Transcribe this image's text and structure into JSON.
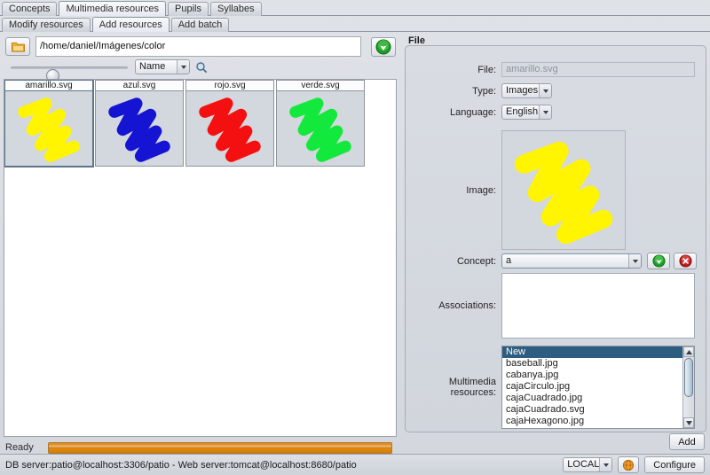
{
  "window": {
    "primary_tabs": [
      {
        "label": "Concepts",
        "active": false
      },
      {
        "label": "Multimedia resources",
        "active": true
      },
      {
        "label": "Pupils",
        "active": false
      },
      {
        "label": "Syllabes",
        "active": false
      }
    ],
    "secondary_tabs": [
      {
        "label": "Modify resources",
        "active": false
      },
      {
        "label": "Add resources",
        "active": true
      },
      {
        "label": "Add batch",
        "active": false
      }
    ]
  },
  "browser": {
    "folder_icon": "folder-icon",
    "path_value": "/home/daniel/Imágenes/color",
    "go_icon": "green-go-arrow-icon",
    "zoom_slider_value": 30,
    "sort_combo_value": "Name",
    "search_icon": "magnifier-icon",
    "files": [
      {
        "name": "amarillo.svg",
        "color": "#FFF500",
        "selected": true
      },
      {
        "name": "azul.svg",
        "color": "#1414D2",
        "selected": false
      },
      {
        "name": "rojo.svg",
        "color": "#F41010",
        "selected": false
      },
      {
        "name": "verde.svg",
        "color": "#13E93C",
        "selected": false
      }
    ],
    "status_label": "Ready",
    "progress_percent": 100
  },
  "file_panel": {
    "group_title": "File",
    "file_label": "File:",
    "file_value": "amarillo.svg",
    "type_label": "Type:",
    "type_value": "Images",
    "language_label": "Language:",
    "language_value": "English",
    "image_label": "Image:",
    "preview_color": "#FFF500",
    "concept_label": "Concept:",
    "concept_value": "a",
    "concept_add_icon": "green-add-icon",
    "concept_remove_icon": "red-remove-icon",
    "associations_label": "Associations:",
    "associations_value": "",
    "multimedia_label": "Multimedia resources:",
    "multimedia_items": [
      {
        "label": "New",
        "selected": true
      },
      {
        "label": "baseball.jpg",
        "selected": false
      },
      {
        "label": "cabanya.jpg",
        "selected": false
      },
      {
        "label": "cajaCirculo.jpg",
        "selected": false
      },
      {
        "label": "cajaCuadrado.jpg",
        "selected": false
      },
      {
        "label": "cajaCuadrado.svg",
        "selected": false
      },
      {
        "label": "cajaHexagono.jpg",
        "selected": false
      }
    ],
    "add_button_label": "Add"
  },
  "bottom_bar": {
    "server_info": "DB server:patio@localhost:3306/patio - Web server:tomcat@localhost:8680/patio",
    "environment_value": "LOCAL",
    "environment_icon": "orange-globe-icon",
    "configure_label": "Configure"
  },
  "colors": {
    "accent_orange": "#d87c04",
    "selection_blue": "#2d5d80",
    "panel_bg": "#d6dae0"
  }
}
